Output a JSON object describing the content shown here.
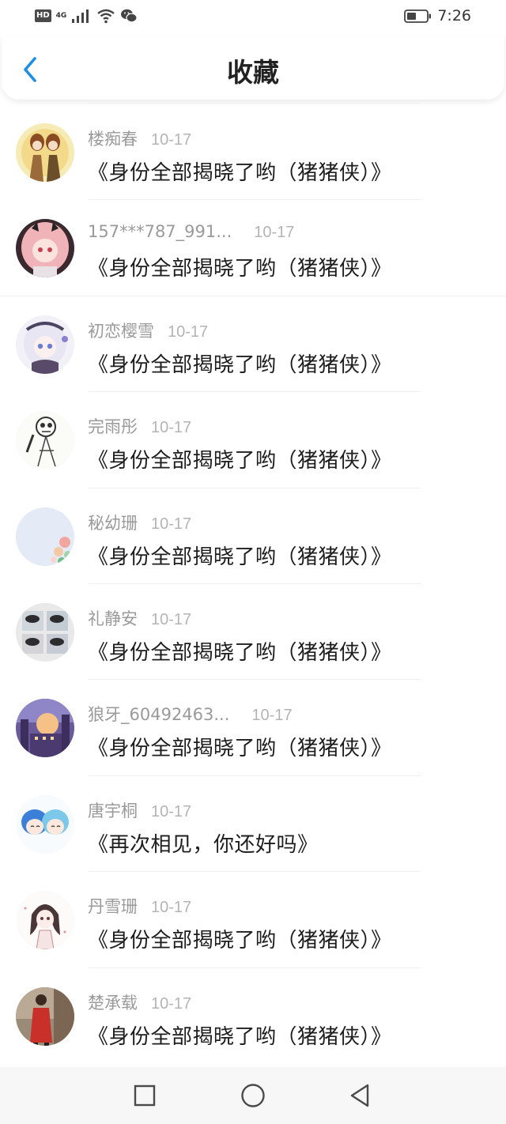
{
  "status_bar": {
    "hd": "HD",
    "network": "4G",
    "time": "7:26",
    "icons": [
      "signal-icon",
      "wifi-icon",
      "wechat-icon",
      "battery-icon"
    ]
  },
  "header": {
    "title": "收藏",
    "back_icon": "chevron-left-icon",
    "accent_color": "#1a8fe3"
  },
  "items": [
    {
      "name": "楼痴春",
      "date": "10-17",
      "title": "《身份全部揭晓了哟（猪猪侠）》",
      "avatar": "avatar-illustration-two-girls"
    },
    {
      "name": "157***787_991...",
      "date": "10-17",
      "title": "《身份全部揭晓了哟（猪猪侠）》",
      "avatar": "avatar-anime-pink-girl"
    },
    {
      "name": "初恋樱雪",
      "date": "10-17",
      "title": "《身份全部揭晓了哟（猪猪侠）》",
      "avatar": "avatar-anime-white-hair"
    },
    {
      "name": "完雨彤",
      "date": "10-17",
      "title": "《身份全部揭晓了哟（猪猪侠）》",
      "avatar": "avatar-sketch-skeleton"
    },
    {
      "name": "秘幼珊",
      "date": "10-17",
      "title": "《身份全部揭晓了哟（猪猪侠）》",
      "avatar": "avatar-flowers"
    },
    {
      "name": "礼静安",
      "date": "10-17",
      "title": "《身份全部揭晓了哟（猪猪侠）》",
      "avatar": "avatar-photo-grid"
    },
    {
      "name": "狼牙_60492463...",
      "date": "10-17",
      "title": "《身份全部揭晓了哟（猪猪侠）》",
      "avatar": "avatar-sunset-city"
    },
    {
      "name": "唐宇桐",
      "date": "10-17",
      "title": "《再次相见，你还好吗》",
      "avatar": "avatar-chibi-blue-hair"
    },
    {
      "name": "丹雪珊",
      "date": "10-17",
      "title": "《身份全部揭晓了哟（猪猪侠）》",
      "avatar": "avatar-sketch-girl"
    },
    {
      "name": "楚承载",
      "date": "10-17",
      "title": "《身份全部揭晓了哟（猪猪侠）》",
      "avatar": "avatar-photo-red-coat"
    }
  ],
  "system_nav": {
    "icons": [
      "recent-apps-icon",
      "home-icon",
      "back-triangle-icon"
    ]
  }
}
